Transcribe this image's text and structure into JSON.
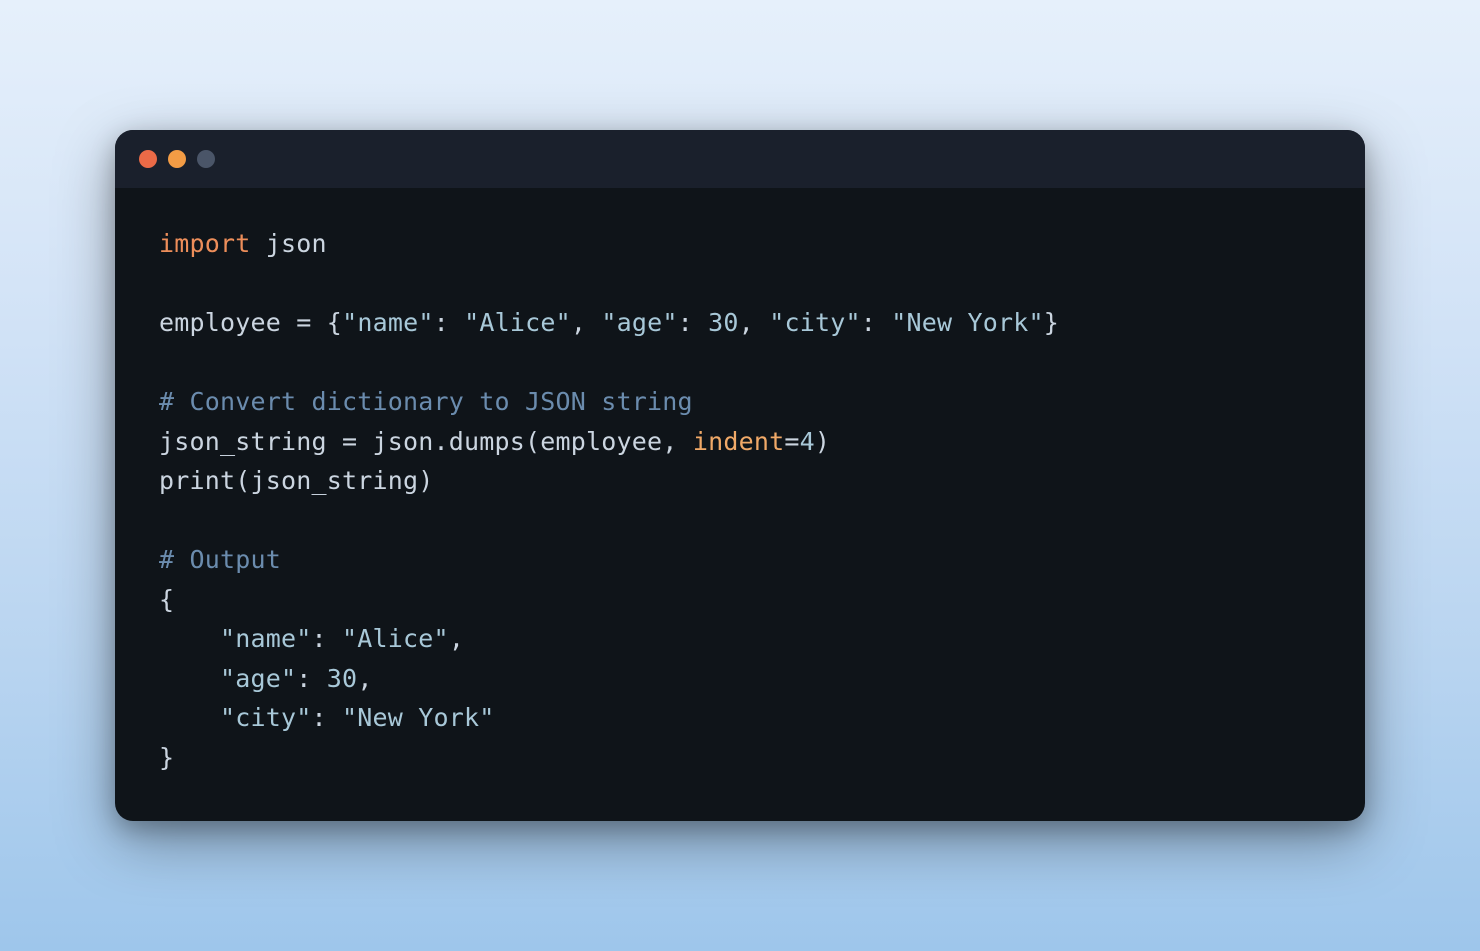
{
  "window": {
    "traffic_lights": {
      "red": "close",
      "yellow": "minimize",
      "gray": "maximize"
    }
  },
  "code": {
    "line1": {
      "keyword": "import",
      "module": " json"
    },
    "line3": {
      "var": "employee ",
      "op": "=",
      "space": " ",
      "brace_open": "{",
      "key1": "\"name\"",
      "colon1": ": ",
      "val1": "\"Alice\"",
      "comma1": ", ",
      "key2": "\"age\"",
      "colon2": ": ",
      "val2": "30",
      "comma2": ", ",
      "key3": "\"city\"",
      "colon3": ": ",
      "val3": "\"New York\"",
      "brace_close": "}"
    },
    "line5": {
      "comment": "# Convert dictionary to JSON string"
    },
    "line6": {
      "var": "json_string ",
      "op": "=",
      "call": " json.dumps(employee, ",
      "param": "indent",
      "eq": "=",
      "num": "4",
      "close": ")"
    },
    "line7": {
      "call": "print(json_string)"
    },
    "line9": {
      "comment": "# Output"
    },
    "line10": {
      "text": "{"
    },
    "line11": {
      "indent": "    ",
      "key": "\"name\"",
      "colon": ": ",
      "val": "\"Alice\"",
      "comma": ","
    },
    "line12": {
      "indent": "    ",
      "key": "\"age\"",
      "colon": ": ",
      "val": "30",
      "comma": ","
    },
    "line13": {
      "indent": "    ",
      "key": "\"city\"",
      "colon": ": ",
      "val": "\"New York\""
    },
    "line14": {
      "text": "}"
    }
  }
}
